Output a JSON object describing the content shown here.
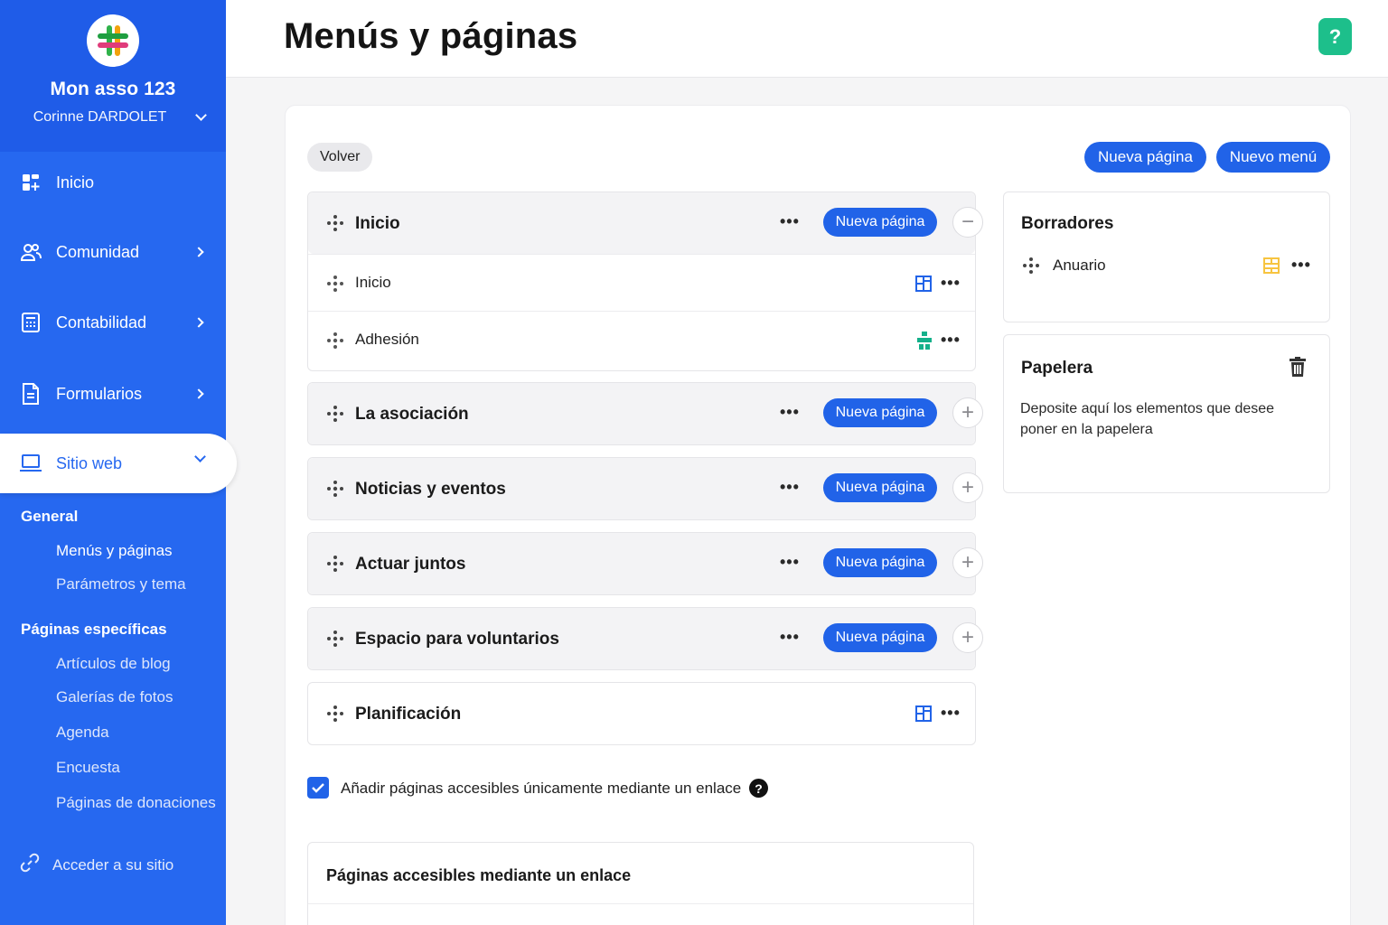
{
  "sidebar": {
    "org_name": "Mon asso 123",
    "user_name": "Corinne DARDOLET",
    "nav": [
      {
        "label": "Inicio",
        "icon": "dashboard-icon"
      },
      {
        "label": "Comunidad",
        "icon": "users-icon"
      },
      {
        "label": "Contabilidad",
        "icon": "calculator-icon"
      },
      {
        "label": "Formularios",
        "icon": "document-icon"
      },
      {
        "label": "Sitio web",
        "icon": "laptop-icon",
        "active": true
      }
    ],
    "section_general": "General",
    "general_items": [
      "Menús y páginas",
      "Parámetros y tema"
    ],
    "section_specific": "Páginas específicas",
    "specific_items": [
      "Artículos de blog",
      "Galerías de fotos",
      "Agenda",
      "Encuesta",
      "Páginas de donaciones"
    ],
    "access_site": "Acceder a su sitio"
  },
  "header": {
    "title": "Menús y páginas",
    "help_label": "?"
  },
  "toolbar": {
    "back_label": "Volver",
    "new_page_label": "Nueva página",
    "new_menu_label": "Nuevo menú"
  },
  "menus": [
    {
      "title": "Inicio",
      "action": "Nueva página",
      "expanded": true,
      "pages": [
        {
          "title": "Inicio"
        },
        {
          "title": "Adhesión"
        }
      ]
    },
    {
      "title": "La asociación",
      "action": "Nueva página"
    },
    {
      "title": "Noticias y eventos",
      "action": "Nueva página"
    },
    {
      "title": "Actuar juntos",
      "action": "Nueva página"
    },
    {
      "title": "Espacio para voluntarios",
      "action": "Nueva página"
    },
    {
      "title": "Planificación"
    }
  ],
  "drafts": {
    "title": "Borradores",
    "items": [
      {
        "title": "Anuario"
      }
    ]
  },
  "trash": {
    "title": "Papelera",
    "description": "Deposite aquí los elementos que desee poner en la papelera"
  },
  "link_option": {
    "label": "Añadir páginas accesibles únicamente mediante un enlace",
    "checked": true
  },
  "link_pages": {
    "title": "Páginas accesibles mediante un enlace"
  },
  "colors": {
    "sidebar": "#2668f0",
    "primary": "#2163e8",
    "help": "#1dbf8b"
  }
}
